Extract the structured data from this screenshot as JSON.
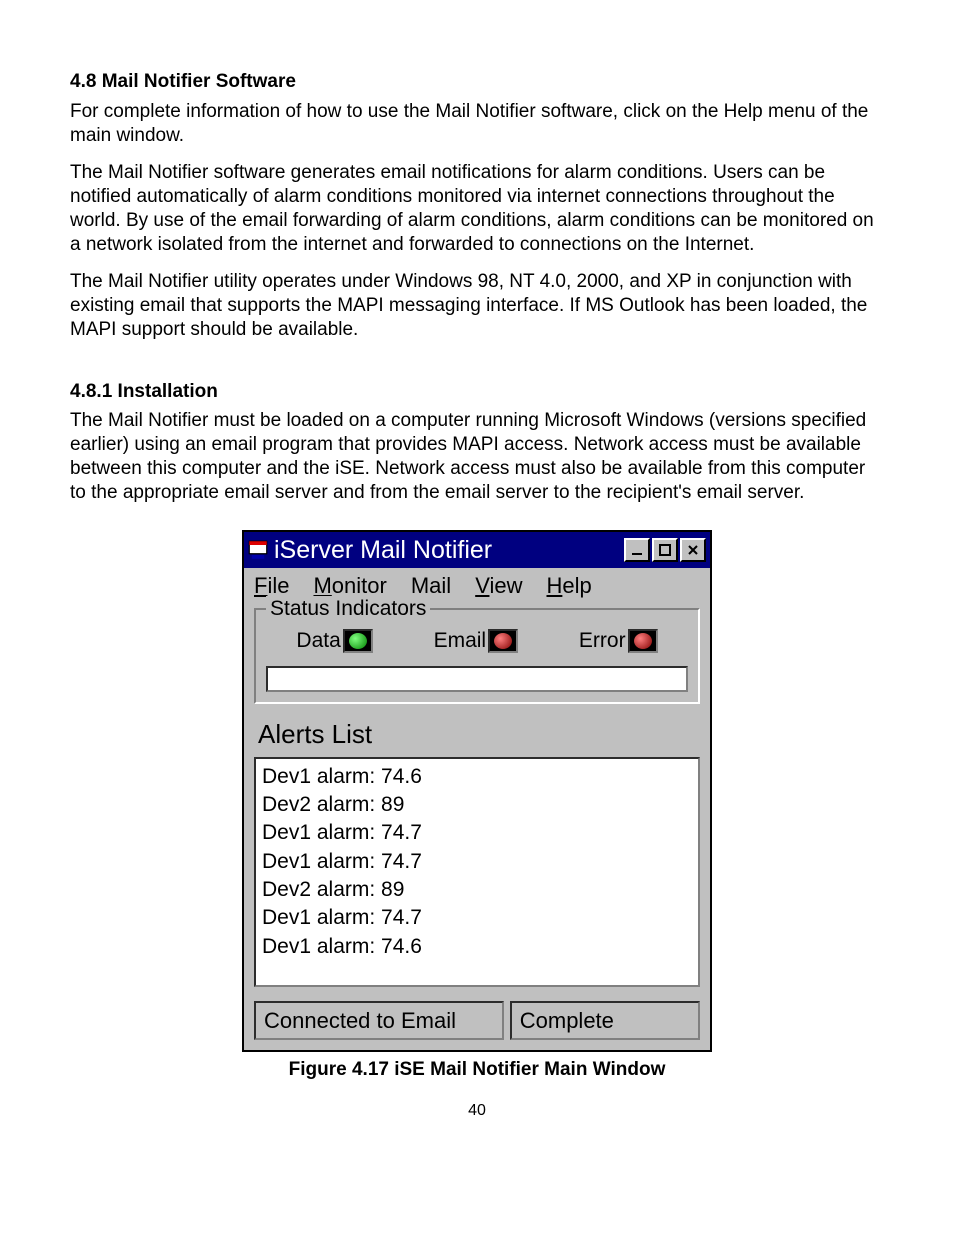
{
  "doc": {
    "section1_heading": "4.8  Mail Notifier Software",
    "para1": "For complete information of how to use the Mail Notifier software, click on the Help menu of the main window.",
    "para2": "The Mail Notifier software generates email notifications for alarm conditions. Users can be notified automatically of alarm conditions monitored via internet connections throughout the world. By use of the email forwarding of alarm conditions, alarm conditions can be monitored on a network isolated from the internet and forwarded to connections on the Internet.",
    "para3": "The Mail Notifier utility operates under Windows 98, NT 4.0, 2000, and XP in conjunction with existing email that supports the MAPI messaging interface. If MS Outlook has been loaded, the MAPI support should be available.",
    "section2_heading": "4.8.1  Installation",
    "para4": "The Mail Notifier must be loaded on a computer running Microsoft Windows (versions specified earlier) using an email program that provides MAPI access. Network access must be available between this computer and the iSE. Network access must also be available from this computer to the appropriate email server and from the email server to the recipient's email server.",
    "figure_caption": "Figure 4.17  iSE Mail Notifier Main Window",
    "page_number": "40"
  },
  "window": {
    "title": "iServer Mail Notifier",
    "menus": {
      "file": "File",
      "monitor": "Monitor",
      "mail": "Mail",
      "view": "View",
      "help": "Help"
    },
    "status_group_label": "Status Indicators",
    "indicators": {
      "data": "Data",
      "email": "Email",
      "error": "Error"
    },
    "alerts_heading": "Alerts List",
    "alerts": [
      "Dev1 alarm: 74.6",
      "Dev2 alarm: 89",
      "Dev1 alarm: 74.7",
      "Dev1 alarm: 74.7",
      "Dev2 alarm: 89",
      "Dev1 alarm: 74.7",
      "Dev1 alarm: 74.6"
    ],
    "statusbar": {
      "left": "Connected to Email",
      "right": "Complete"
    }
  }
}
